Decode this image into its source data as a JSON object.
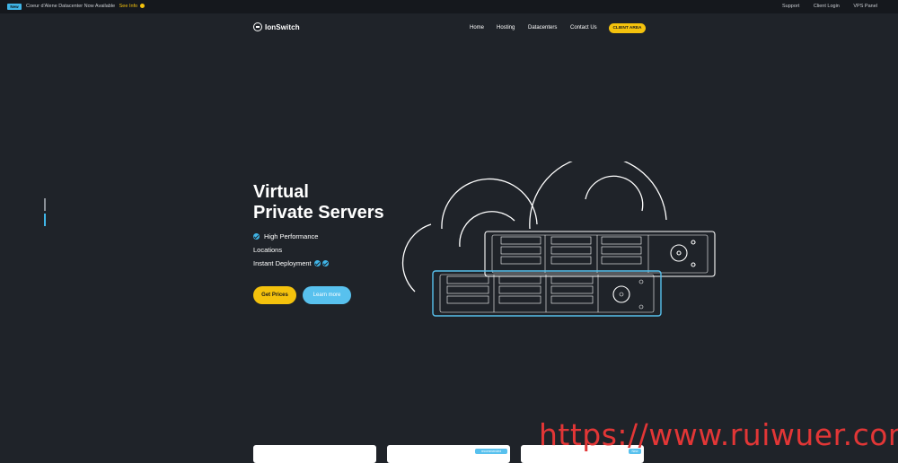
{
  "topbar": {
    "badge": "New",
    "announcement": "Coeur d'Alene Datacenter Now Available",
    "see_info": "See Info",
    "links": [
      "Support",
      "Client Login",
      "VPS Panel"
    ]
  },
  "header": {
    "logo": "IonSwitch",
    "nav": [
      "Home",
      "Hosting",
      "Datacenters",
      "Contact Us"
    ],
    "client_area": "CLIENT AREA"
  },
  "hero": {
    "title_line1": "Virtual",
    "title_line2": "Private Servers",
    "features": [
      "High Performance",
      "Locations",
      "Instant Deployment"
    ],
    "get_prices": "Get Prices",
    "learn_more": "Learn more"
  },
  "cards": {
    "tag_recommended": "recommended",
    "tag_new": "New"
  },
  "watermark": "https://www.ruiwuer.com",
  "colors": {
    "background": "#1f2329",
    "accent_yellow": "#f4c20d",
    "accent_blue": "#3fb4e6",
    "watermark": "#e23636"
  }
}
